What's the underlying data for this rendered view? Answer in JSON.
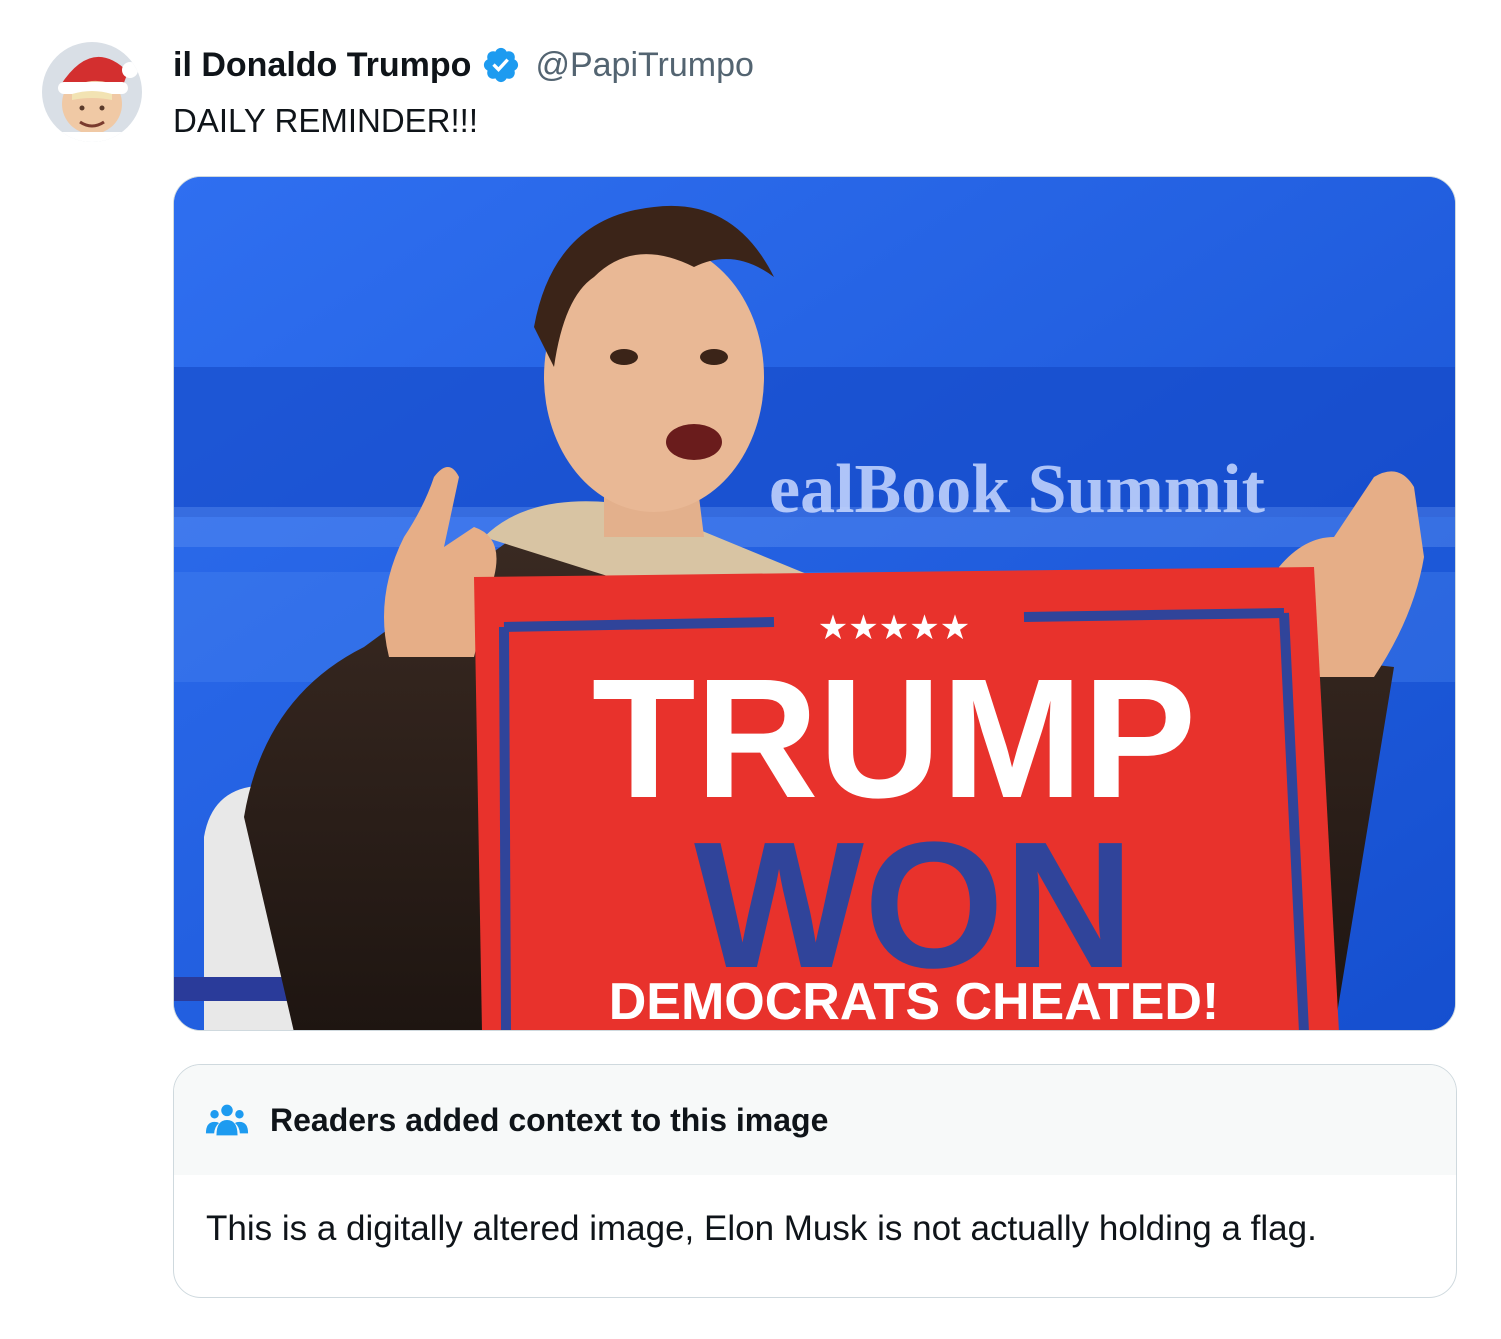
{
  "post": {
    "author_name": "il Donaldo Trumpo",
    "author_handle": "@PapiTrumpo",
    "verified": true,
    "text": "DAILY REMINDER!!!"
  },
  "media": {
    "backdrop_text": "ealBook Summit",
    "flag": {
      "stars": "★★★★★",
      "line1": "TRUMP",
      "line2": "WON",
      "line3": "DEMOCRATS CHEATED!"
    }
  },
  "community_note": {
    "title": "Readers added context to this image",
    "body": "This is a digitally altered image, Elon Musk is not actually holding a flag."
  },
  "colors": {
    "verified_blue": "#1d9bf0",
    "secondary_text": "#536471",
    "border": "#cfd9de",
    "note_header_bg": "#f7f9f9",
    "flag_red": "#e8322c",
    "flag_blue": "#30449a",
    "stage_blue": "#1a5fe0"
  },
  "icons": {
    "verified": "verified-badge-icon",
    "note": "people-group-icon"
  }
}
